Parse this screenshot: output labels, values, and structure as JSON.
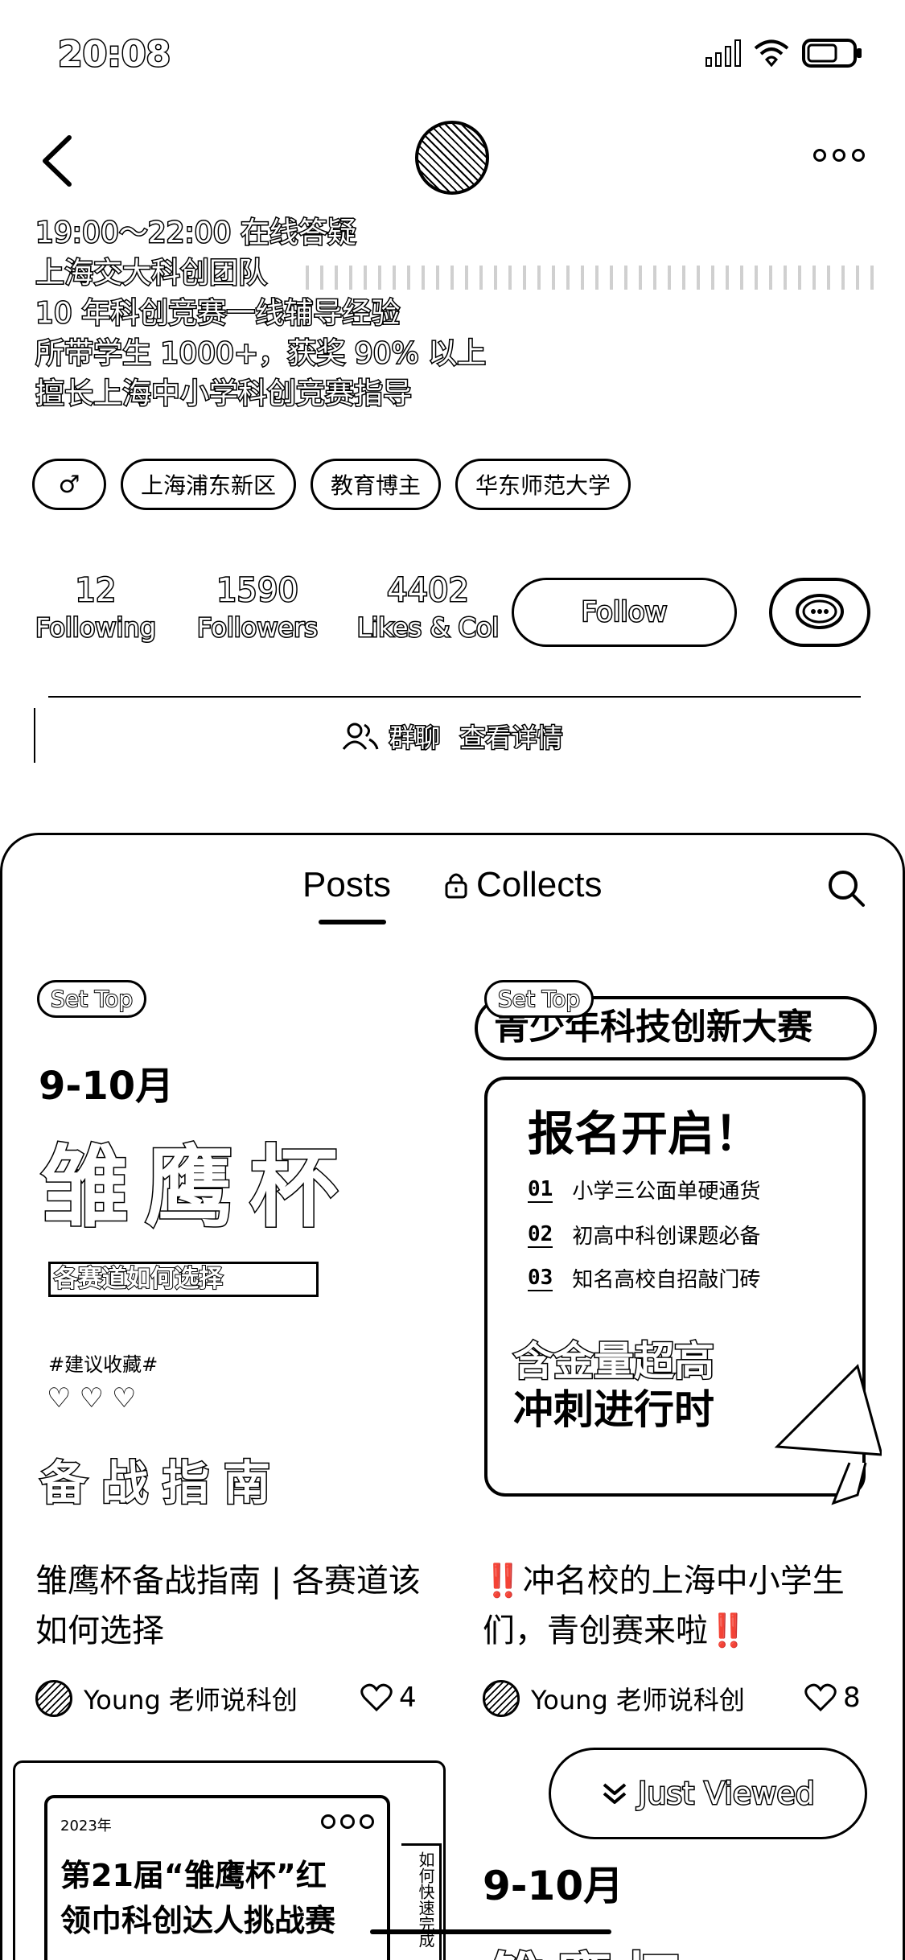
{
  "status": {
    "time": "20:08"
  },
  "bio": [
    "19:00～22:00 在线答疑",
    "上海交大科创团队",
    "10 年科创竞赛一线辅导经验",
    "所带学生 1000+，获奖 90% 以上",
    "擅长上海中小学科创竞赛指导"
  ],
  "tags": {
    "gender": "♂",
    "items": [
      "上海浦东新区",
      "教育博主",
      "华东师范大学"
    ]
  },
  "stats": [
    {
      "num": "12",
      "label": "Following"
    },
    {
      "num": "1590",
      "label": "Followers"
    },
    {
      "num": "4402",
      "label": "Likes & Col"
    }
  ],
  "follow_label": "Follow",
  "group": {
    "label": "群聊",
    "detail": "查看详情"
  },
  "tabs": {
    "posts": "Posts",
    "collects": "Collects"
  },
  "cards": [
    {
      "set_top": "Set Top",
      "cover": {
        "date": "9-10月",
        "big": "雏鹰杯",
        "box": "各赛道如何选择",
        "hash": "#建议收藏#",
        "hearts": "♡♡♡",
        "guide": "备战指南"
      },
      "title": "雏鹰杯备战指南 | 各赛道该如何选择",
      "author": "Young 老师说科创",
      "likes": "4"
    },
    {
      "set_top": "Set Top",
      "cover": {
        "banner": "青少年科技创新大赛",
        "heading": "报名开启！",
        "items": [
          {
            "no": "01",
            "text": "小学三公面单硬通货"
          },
          {
            "no": "02",
            "text": "初高中科创课题必备"
          },
          {
            "no": "03",
            "text": "知名高校自招敲门砖"
          }
        ],
        "line1": "含金量超高",
        "line2": "冲刺进行时"
      },
      "title": "‼️冲名校的上海中小学生们，青创赛来啦‼️",
      "author": "Young 老师说科创",
      "likes": "8"
    }
  ],
  "bottom": {
    "year": "2023年",
    "title1": "第21届“雏鹰杯”红",
    "title2": "领巾科创达人挑战赛",
    "side": "如何快速完成",
    "just_viewed": "Just Viewed",
    "date": "9-10月",
    "big": "雏鹰杯"
  }
}
